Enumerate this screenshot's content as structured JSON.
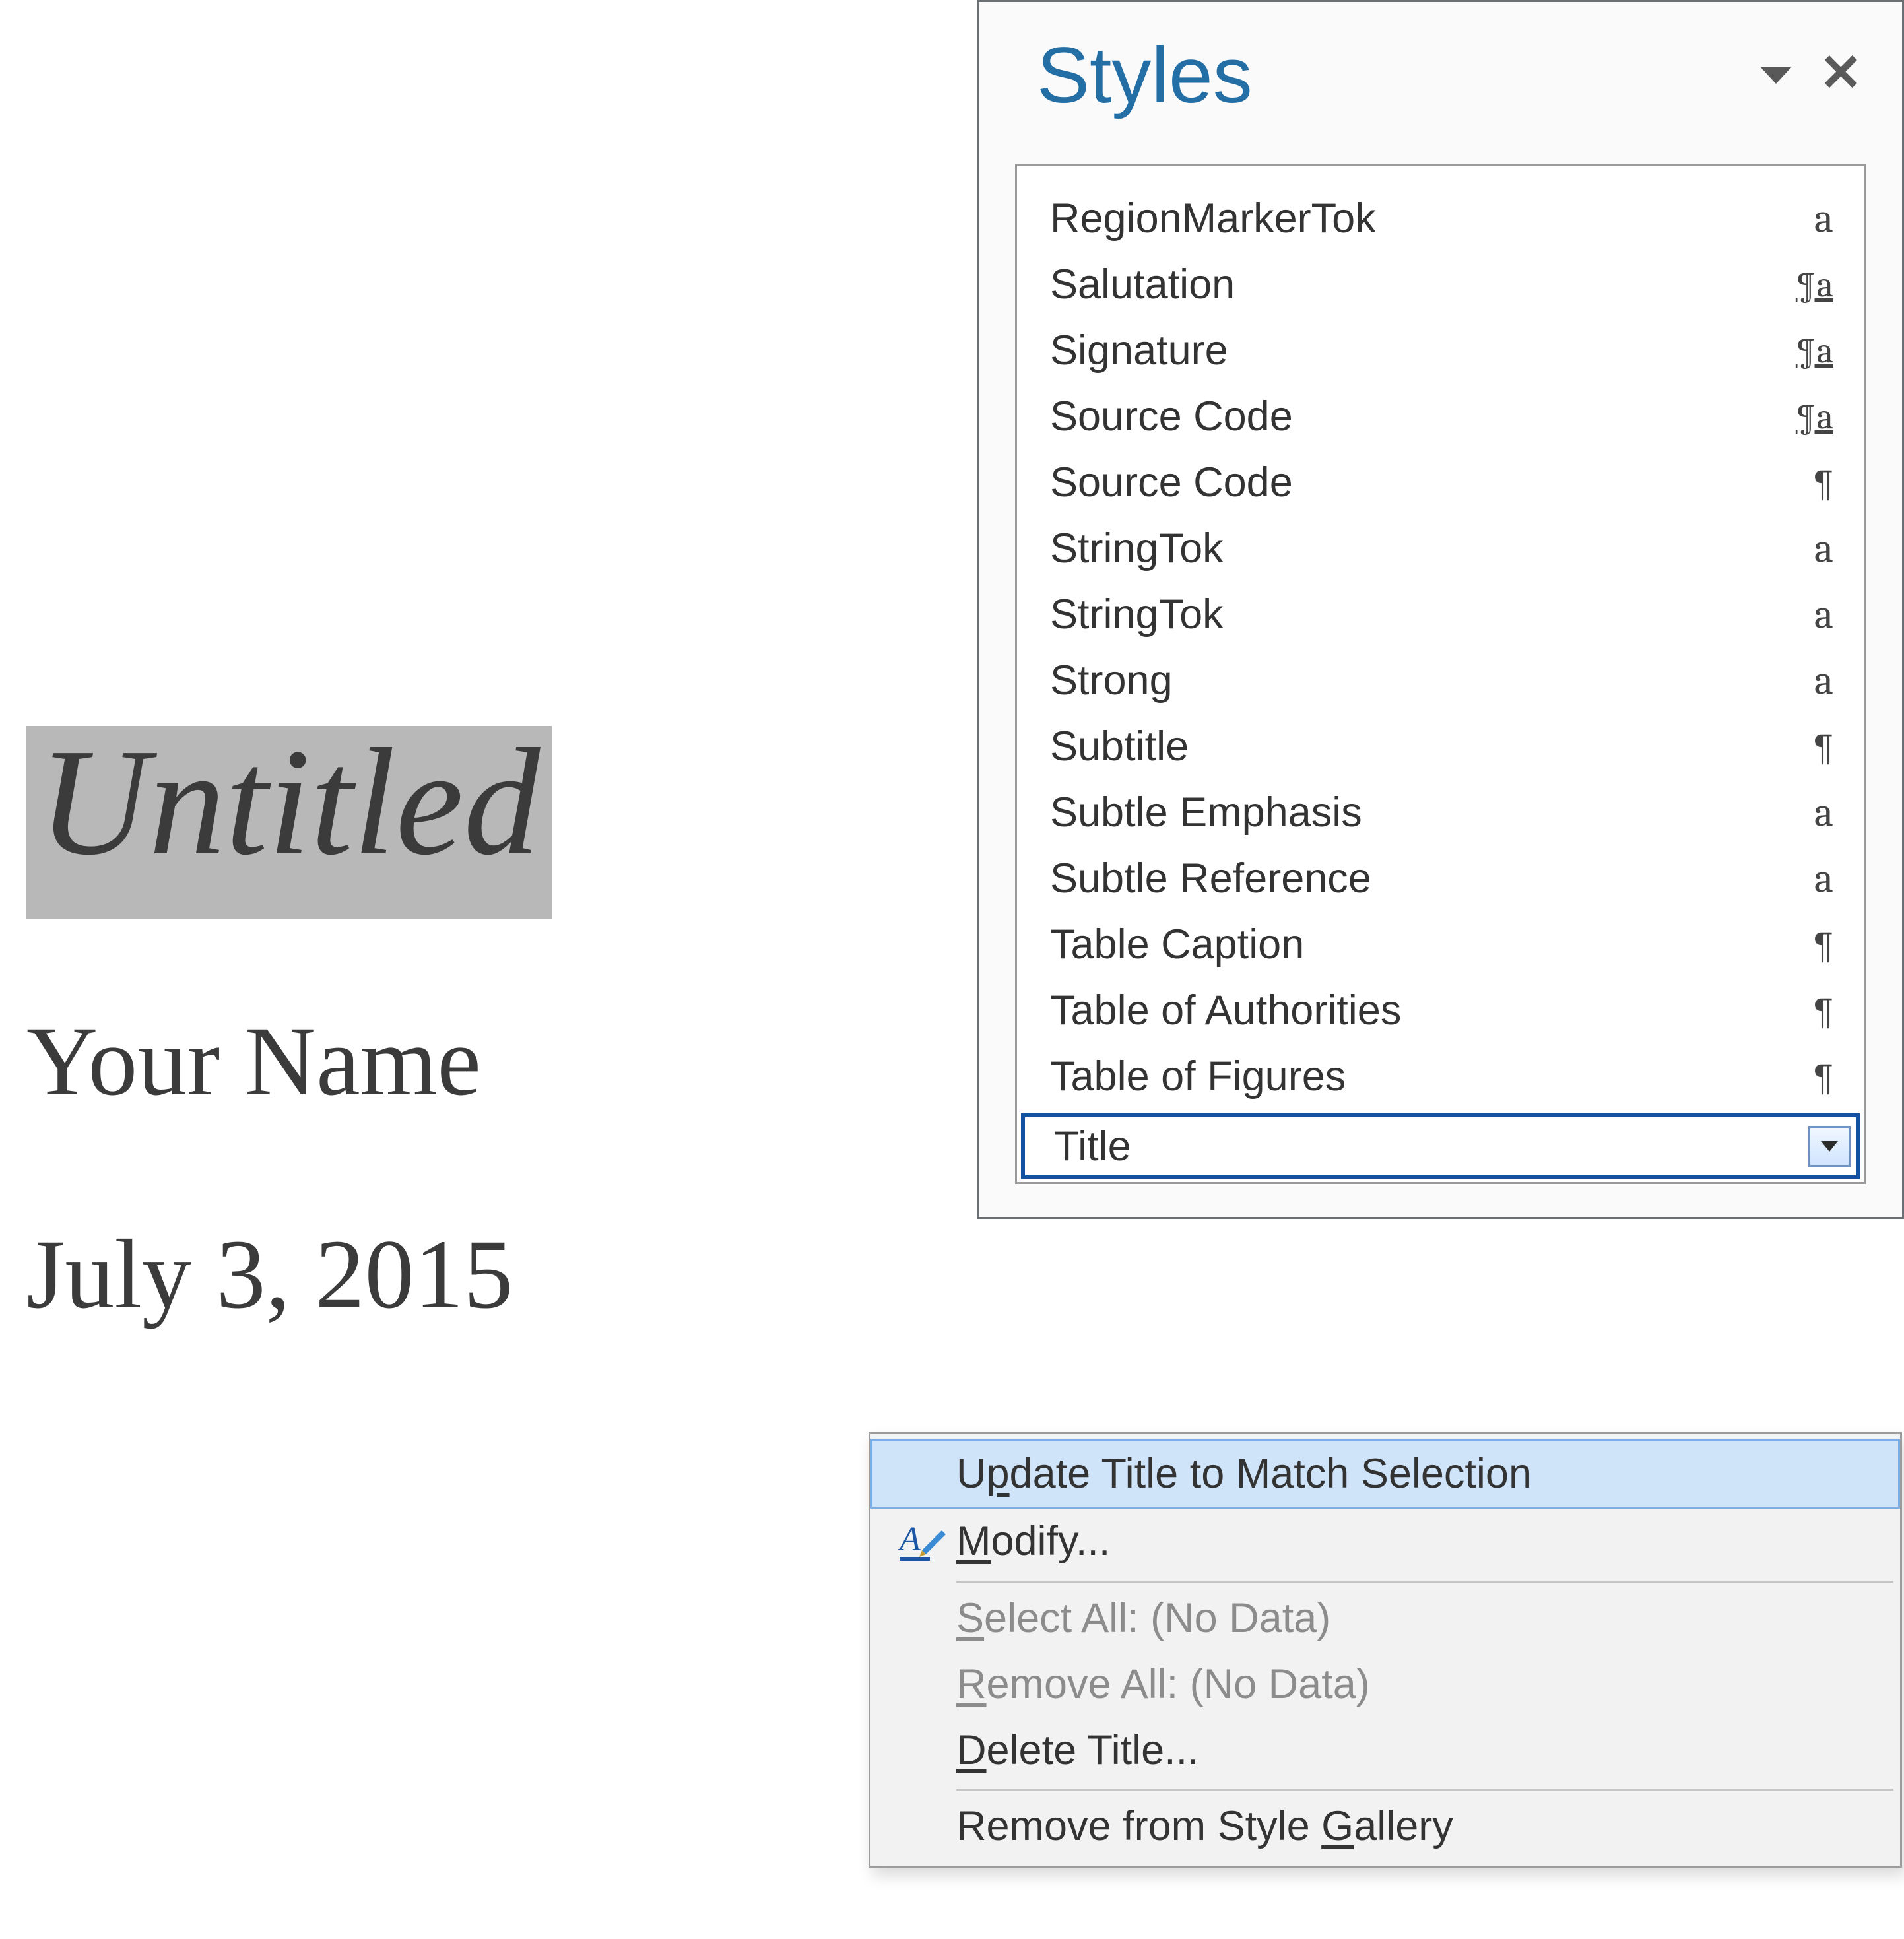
{
  "document": {
    "title": "Untitled",
    "author": "Your Name",
    "date": "July 3, 2015"
  },
  "pane": {
    "title": "Styles",
    "styles": [
      {
        "name": "RegionMarkerTok",
        "type": "char"
      },
      {
        "name": "Salutation",
        "type": "linked"
      },
      {
        "name": "Signature",
        "type": "linked"
      },
      {
        "name": "Source Code",
        "type": "linked"
      },
      {
        "name": "Source Code",
        "type": "para"
      },
      {
        "name": "StringTok",
        "type": "char"
      },
      {
        "name": "StringTok",
        "type": "char"
      },
      {
        "name": "Strong",
        "type": "char"
      },
      {
        "name": "Subtitle",
        "type": "para"
      },
      {
        "name": "Subtle Emphasis",
        "type": "char"
      },
      {
        "name": "Subtle Reference",
        "type": "char"
      },
      {
        "name": "Table Caption",
        "type": "para"
      },
      {
        "name": "Table of Authorities",
        "type": "para"
      },
      {
        "name": "Table of Figures",
        "type": "para"
      }
    ],
    "selected": {
      "name": "Title"
    }
  },
  "menu": {
    "update": "Update Title to Match Selection",
    "modify": "Modify...",
    "selectAll": "Select All: (No Data)",
    "removeAll": "Remove All: (No Data)",
    "deleteStyle": "Delete Title...",
    "removeGallery": "Remove from Style Gallery"
  },
  "icons": {
    "char": "a",
    "para": "¶",
    "linked": "¶a"
  }
}
